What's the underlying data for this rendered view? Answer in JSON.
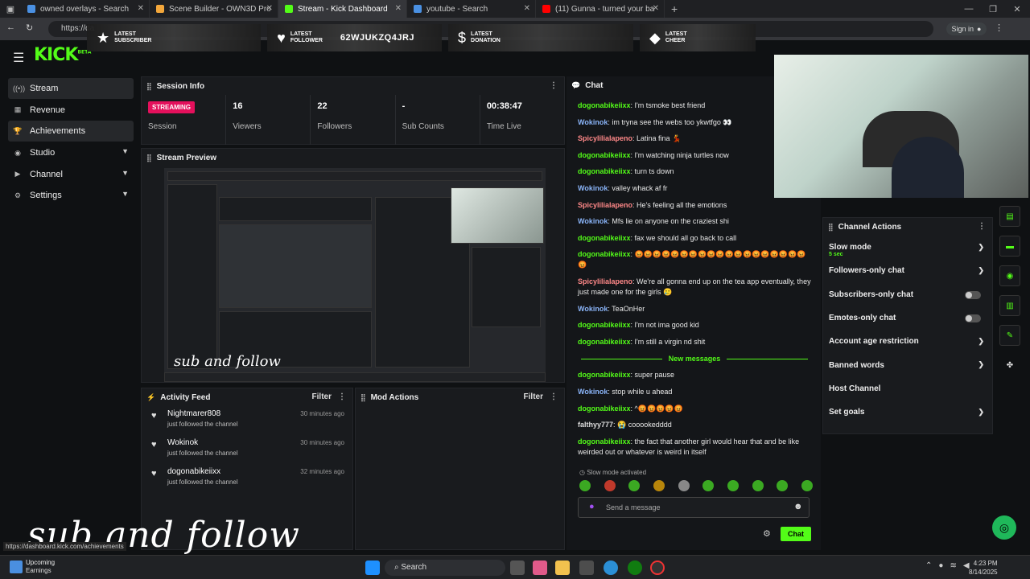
{
  "browser": {
    "tabs": [
      {
        "label": "owned overlays - Search",
        "color": "#4a90e2"
      },
      {
        "label": "Scene Builder - OWN3D Pro",
        "color": "#f3a73b"
      },
      {
        "label": "Stream - Kick Dashboard",
        "color": "#53fc18"
      },
      {
        "label": "youtube - Search",
        "color": "#4a90e2"
      },
      {
        "label": "(11) Gunna - turned your ba",
        "color": "#ff0000"
      }
    ],
    "url_fragment": "https://da",
    "signin": "Sign in"
  },
  "overlay": {
    "latest_subscriber": "LATEST SUBSCRIBER",
    "latest_follower": "LATEST FOLLOWER",
    "follower_name": "62WJUKZQ4JRJ",
    "latest_donation": "LATEST DONATION",
    "latest_cheer": "LATEST CHEER"
  },
  "brand": {
    "logo": "KICK",
    "tag": "BETA"
  },
  "sidebar": {
    "items": [
      {
        "label": "Stream",
        "icon": "broadcast-icon"
      },
      {
        "label": "Revenue",
        "icon": "chart-icon"
      },
      {
        "label": "Achievements",
        "icon": "trophy-icon"
      },
      {
        "label": "Studio",
        "icon": "studio-icon"
      },
      {
        "label": "Channel",
        "icon": "channel-icon"
      },
      {
        "label": "Settings",
        "icon": "gear-icon"
      }
    ]
  },
  "session": {
    "title": "Session Info",
    "status": "STREAMING",
    "status_label": "Session",
    "viewers": "16",
    "viewers_label": "Viewers",
    "followers": "22",
    "followers_label": "Followers",
    "subs": "-",
    "subs_label": "Sub Counts",
    "time": "00:38:47",
    "time_label": "Time Live"
  },
  "preview": {
    "title": "Stream Preview",
    "caption": "sub and follow"
  },
  "activity": {
    "title": "Activity Feed",
    "filter": "Filter",
    "items": [
      {
        "name": "Nightmarer808",
        "desc": "just followed the channel",
        "time": "30 minutes ago"
      },
      {
        "name": "Wokinok",
        "desc": "just followed the channel",
        "time": "30 minutes ago"
      },
      {
        "name": "dogonabikeiixx",
        "desc": "just followed the channel",
        "time": "32 minutes ago"
      }
    ]
  },
  "modactions": {
    "title": "Mod Actions",
    "filter": "Filter"
  },
  "chat": {
    "title": "Chat",
    "messages": [
      {
        "user": "dogonabikeiixx",
        "text": ": I'm tsmoke best friend",
        "c": "ug"
      },
      {
        "user": "Wokinok",
        "text": ": im tryna see the webs too ykwtfgo 👀",
        "c": "ub"
      },
      {
        "user": "Spicylilialapeno",
        "text": ": Latina fina 💃",
        "c": "ur"
      },
      {
        "user": "dogonabikeiixx",
        "text": ": I'm watching ninja turtles now",
        "c": "ug"
      },
      {
        "user": "dogonabikeiixx",
        "text": ": turn ts down",
        "c": "ug"
      },
      {
        "user": "Wokinok",
        "text": ": valley whack af fr",
        "c": "ub"
      },
      {
        "user": "Spicylilialapeno",
        "text": ": He's feeling all the emotions",
        "c": "ur"
      },
      {
        "user": "Wokinok",
        "text": ": Mfs lie on anyone on the craziest shi",
        "c": "ub"
      },
      {
        "user": "dogonabikeiixx",
        "text": ": fax we should all go back to call",
        "c": "ug"
      },
      {
        "user": "dogonabikeiixx",
        "text": ": 😡😡😡😡😡😡😡😡😡😡😡😡😡😡😡😡😡😡😡😡",
        "c": "ug"
      },
      {
        "user": "Spicylilialapeno",
        "text": ": We're all gonna end up on the tea app eventually, they just made one for the girls 🥲",
        "c": "ur"
      },
      {
        "user": "Wokinok",
        "text": ": TeaOnHer",
        "c": "ub"
      },
      {
        "user": "dogonabikeiixx",
        "text": ": I'm not ima good kid",
        "c": "ug"
      },
      {
        "user": "dogonabikeiixx",
        "text": ": I'm still a virgin nd shit",
        "c": "ug"
      }
    ],
    "new_label": "New messages",
    "new_messages": [
      {
        "user": "dogonabikeiixx",
        "text": ": super pause",
        "c": "ug"
      },
      {
        "user": "Wokinok",
        "text": ": stop while u ahead",
        "c": "ub"
      },
      {
        "user": "dogonabikeiixx",
        "text": ": ^😡😡😡😡😡",
        "c": "ug"
      },
      {
        "user": "falthyy777",
        "text": ": 😭 cooookedddd",
        "c": "uw"
      },
      {
        "user": "dogonabikeiixx",
        "text": ": the fact that another girl would hear that and be like weirded out or whatever is weird in itself",
        "c": "ug"
      }
    ],
    "slow_mode": "Slow mode activated",
    "placeholder": "Send a message",
    "send": "Chat"
  },
  "actions": {
    "title": "Channel Actions",
    "items": [
      {
        "label": "Slow mode",
        "sub": "5 sec",
        "kind": "arrow"
      },
      {
        "label": "Followers-only chat",
        "kind": "arrow"
      },
      {
        "label": "Subscribers-only chat",
        "kind": "toggle"
      },
      {
        "label": "Emotes-only chat",
        "kind": "toggle"
      },
      {
        "label": "Account age restriction",
        "kind": "arrow"
      },
      {
        "label": "Banned words",
        "kind": "arrow"
      },
      {
        "label": "Host Channel",
        "kind": "none"
      },
      {
        "label": "Set goals",
        "kind": "arrow"
      }
    ]
  },
  "caption_big": "sub and follow",
  "status_url": "https://dashboard.kick.com/achievements",
  "taskbar": {
    "weather_title": "Upcoming",
    "weather_sub": "Earnings",
    "search": "Search",
    "time": "4:23 PM",
    "date": "8/14/2025"
  }
}
